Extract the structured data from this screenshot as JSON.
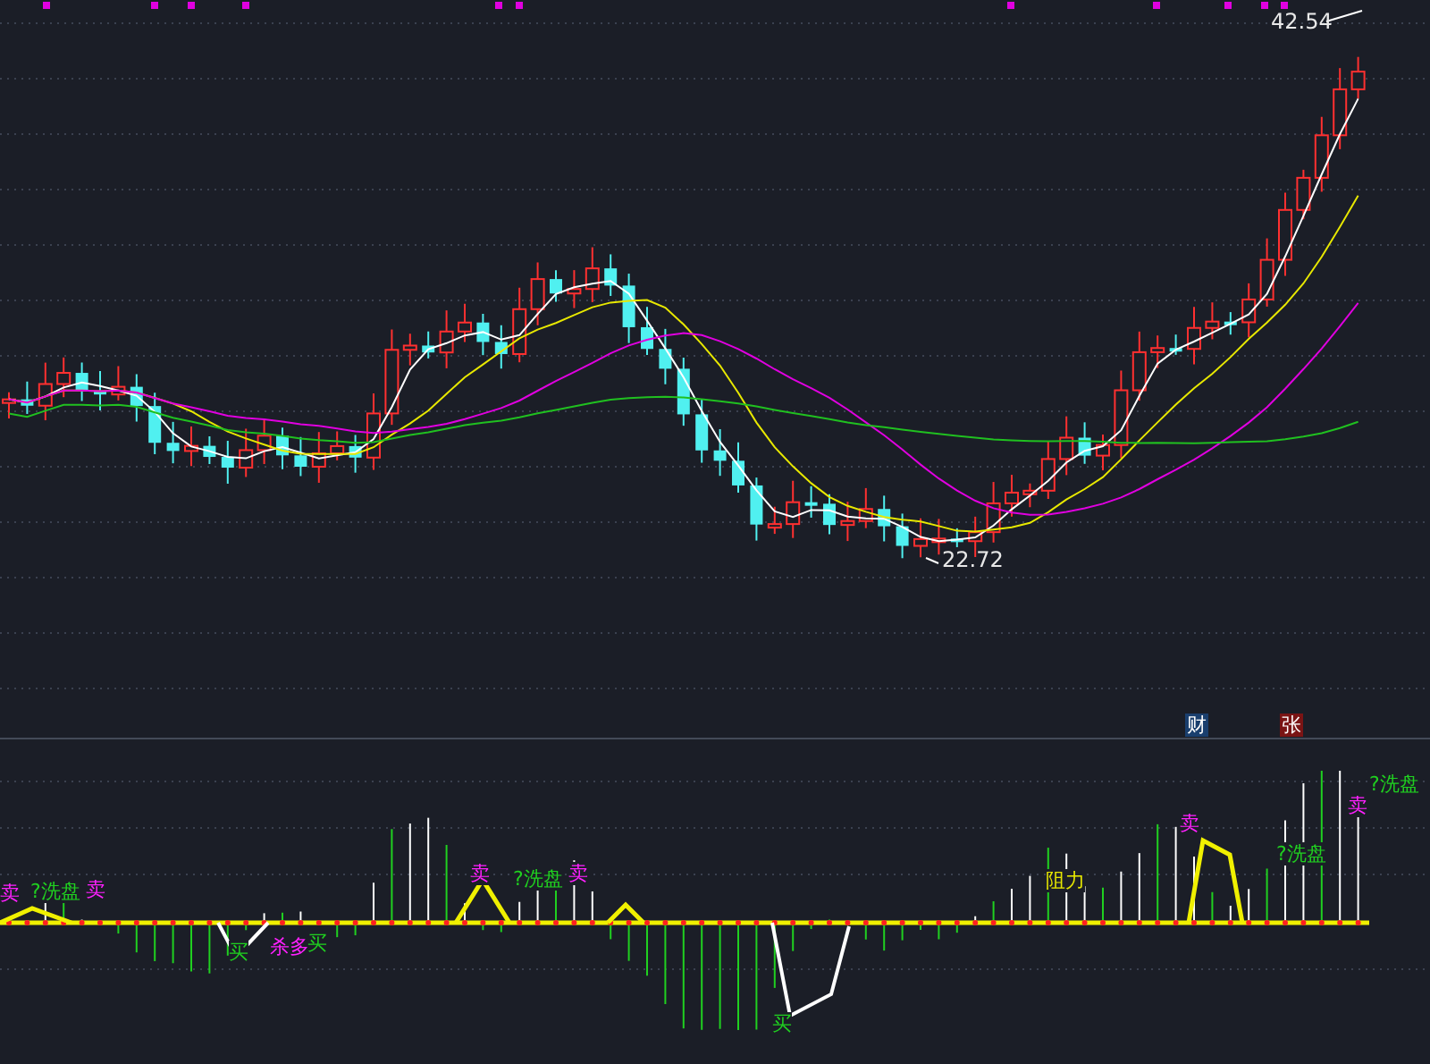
{
  "price_chart": {
    "high_label": "42.54",
    "low_label": "22.72"
  },
  "indicator_panel": {
    "badges": [
      {
        "text": "财",
        "color": "#1a3f6e"
      },
      {
        "text": "张",
        "color": "#7a1414"
      }
    ],
    "signals": [
      {
        "text": "卖",
        "kind": "sell"
      },
      {
        "text": "?洗盘",
        "kind": "wash"
      },
      {
        "text": "卖",
        "kind": "sell"
      },
      {
        "text": "买",
        "kind": "buy"
      },
      {
        "text": "杀多",
        "kind": "sell"
      },
      {
        "text": "买",
        "kind": "buy"
      },
      {
        "text": "卖",
        "kind": "sell"
      },
      {
        "text": "?洗盘",
        "kind": "wash"
      },
      {
        "text": "卖",
        "kind": "sell"
      },
      {
        "text": "买",
        "kind": "buy"
      },
      {
        "text": "阻力",
        "kind": "resist"
      },
      {
        "text": "卖",
        "kind": "sell"
      },
      {
        "text": "?洗盘",
        "kind": "wash"
      },
      {
        "text": "卖",
        "kind": "sell"
      },
      {
        "text": "?洗盘",
        "kind": "wash"
      }
    ]
  }
}
